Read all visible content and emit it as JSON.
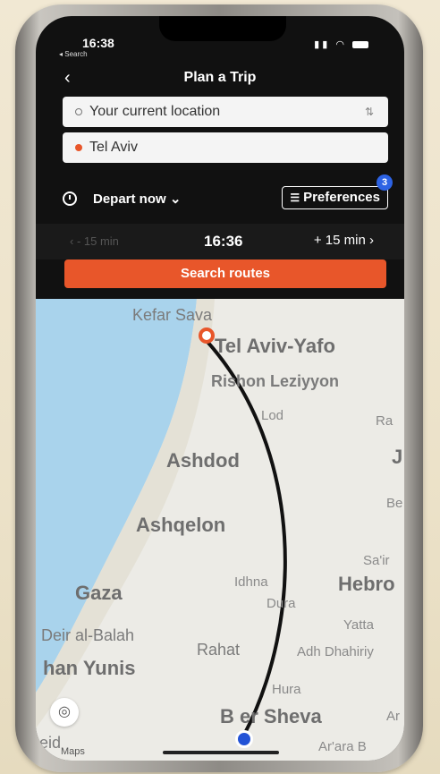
{
  "status": {
    "time": "16:38",
    "back_to": "◂ Search"
  },
  "header": {
    "back_glyph": "‹",
    "title": "Plan a Trip"
  },
  "trip": {
    "origin": "Your current location",
    "destination": "Tel Aviv",
    "swap_glyph": "⇅"
  },
  "options": {
    "depart": "Depart now ⌄",
    "preferences_label": "Preferences",
    "preferences_badge": "3"
  },
  "time_selector": {
    "prev": "‹ - 15 min",
    "current": "16:36",
    "next": "+ 15 min ›"
  },
  "search_label": "Search routes",
  "map": {
    "labels": {
      "kefar_sava": "Kefar Sava",
      "tel_aviv_yafo": "Tel Aviv-Yafo",
      "rishon": "Rishon Leziyyon",
      "lod": "Lod",
      "ra": "Ra",
      "ashdod": "Ashdod",
      "be": "Be",
      "j": "J",
      "ashqelon": "Ashqelon",
      "sair": "Sa'ir",
      "gaza": "Gaza",
      "idhna": "Idhna",
      "hebron": "Hebro",
      "dura": "Dura",
      "yatta": "Yatta",
      "deir_al_balah": "Deir al-Balah",
      "rahat": "Rahat",
      "adh_dhahiriya": "Adh Dhahiriy",
      "khan_yunis": "han Yunis",
      "hura": "Hura",
      "beer_sheva": "B  er Sheva",
      "ar": "Ar",
      "arara": "Ar'ara B",
      "rafah_partial": "eid"
    },
    "attribution": "Maps",
    "locate_glyph": "◎"
  },
  "colors": {
    "accent": "#e8562a",
    "badge": "#2d63e4",
    "route": "#111111",
    "sea": "#a9d3ec"
  }
}
